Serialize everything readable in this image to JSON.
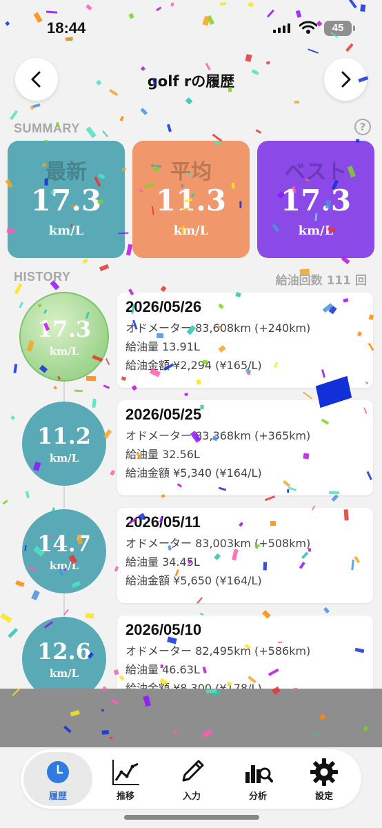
{
  "status_bar": {
    "time": "18:44",
    "battery": "45"
  },
  "header": {
    "title": "golf rの履歴"
  },
  "summary": {
    "label": "SUMMARY",
    "help": "?",
    "cards": [
      {
        "title": "最新",
        "value": "17.3",
        "unit": "km/L",
        "color": "#5aa9b6"
      },
      {
        "title": "平均",
        "value": "11.3",
        "unit": "km/L",
        "color": "#f0986c"
      },
      {
        "title": "ベスト",
        "value": "17.3",
        "unit": "km/L",
        "color": "#8b4ae8"
      }
    ]
  },
  "history": {
    "label": "HISTORY",
    "refuel_count": "給油回数 111 回",
    "entries": [
      {
        "value": "17.3",
        "unit": "km/L",
        "date": "2026/05/26",
        "odometer": "オドメーター 83,608km (+240km)",
        "amount": "給油量 13.91L",
        "cost": "給油金額 ¥2,294 (¥165/L)",
        "best": true
      },
      {
        "value": "11.2",
        "unit": "km/L",
        "date": "2026/05/25",
        "odometer": "オドメーター 83,368km (+365km)",
        "amount": "給油量 32.56L",
        "cost": "給油金額 ¥5,340 (¥164/L)"
      },
      {
        "value": "14.7",
        "unit": "km/L",
        "date": "2026/05/11",
        "odometer": "オドメーター 83,003km (+508km)",
        "amount": "給油量 34.45L",
        "cost": "給油金額 ¥5,650 (¥164/L)"
      },
      {
        "value": "12.6",
        "unit": "km/L",
        "date": "2026/05/10",
        "odometer": "オドメーター 82,495km (+586km)",
        "amount": "給油量 46.63L",
        "cost": "給油金額 ¥8,300 (¥178/L)"
      }
    ]
  },
  "tabs": [
    {
      "label": "履歴",
      "icon": "clock-icon",
      "active": true
    },
    {
      "label": "推移",
      "icon": "line-chart-icon"
    },
    {
      "label": "入力",
      "icon": "pencil-icon"
    },
    {
      "label": "分析",
      "icon": "analysis-icon"
    },
    {
      "label": "設定",
      "icon": "gear-icon"
    }
  ]
}
